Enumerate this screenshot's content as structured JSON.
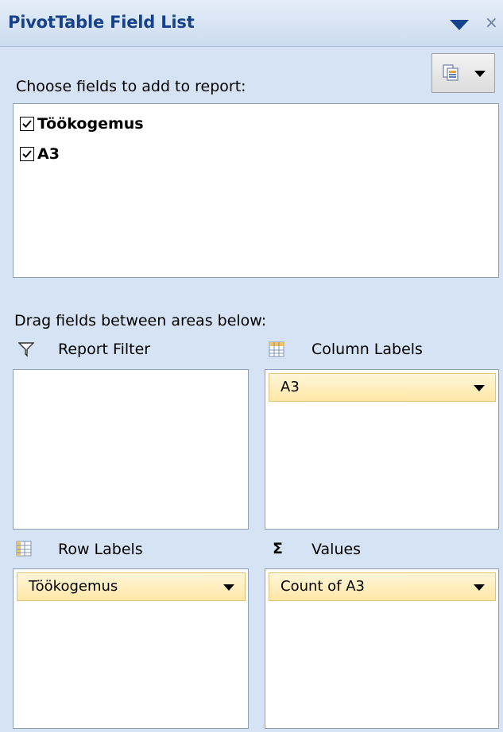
{
  "header": {
    "title": "PivotTable Field List",
    "menu_icon": "triangle-down-icon",
    "close_icon": "close-icon",
    "close_glyph": "×",
    "layout_button_icon": "field-list-layout-icon"
  },
  "fields_section": {
    "prompt": "Choose fields to add to report:",
    "fields": [
      {
        "label": "Töökogemus",
        "checked": true
      },
      {
        "label": "A3",
        "checked": true
      }
    ]
  },
  "areas_section": {
    "prompt": "Drag fields between areas below:",
    "report_filter": {
      "label": "Report Filter",
      "icon": "funnel-icon",
      "items": []
    },
    "column_labels": {
      "label": "Column Labels",
      "icon": "column-grid-icon",
      "items": [
        "A3"
      ]
    },
    "row_labels": {
      "label": "Row Labels",
      "icon": "row-grid-icon",
      "items": [
        "Töökogemus"
      ]
    },
    "values": {
      "label": "Values",
      "icon": "sigma-icon",
      "icon_glyph": "Σ",
      "items": [
        "Count of A3"
      ]
    }
  },
  "colors": {
    "title_text": "#15428b",
    "pane_background": "#d5e3f4",
    "chip_background": "#ffe7a6",
    "box_border": "#8f9fb5"
  }
}
